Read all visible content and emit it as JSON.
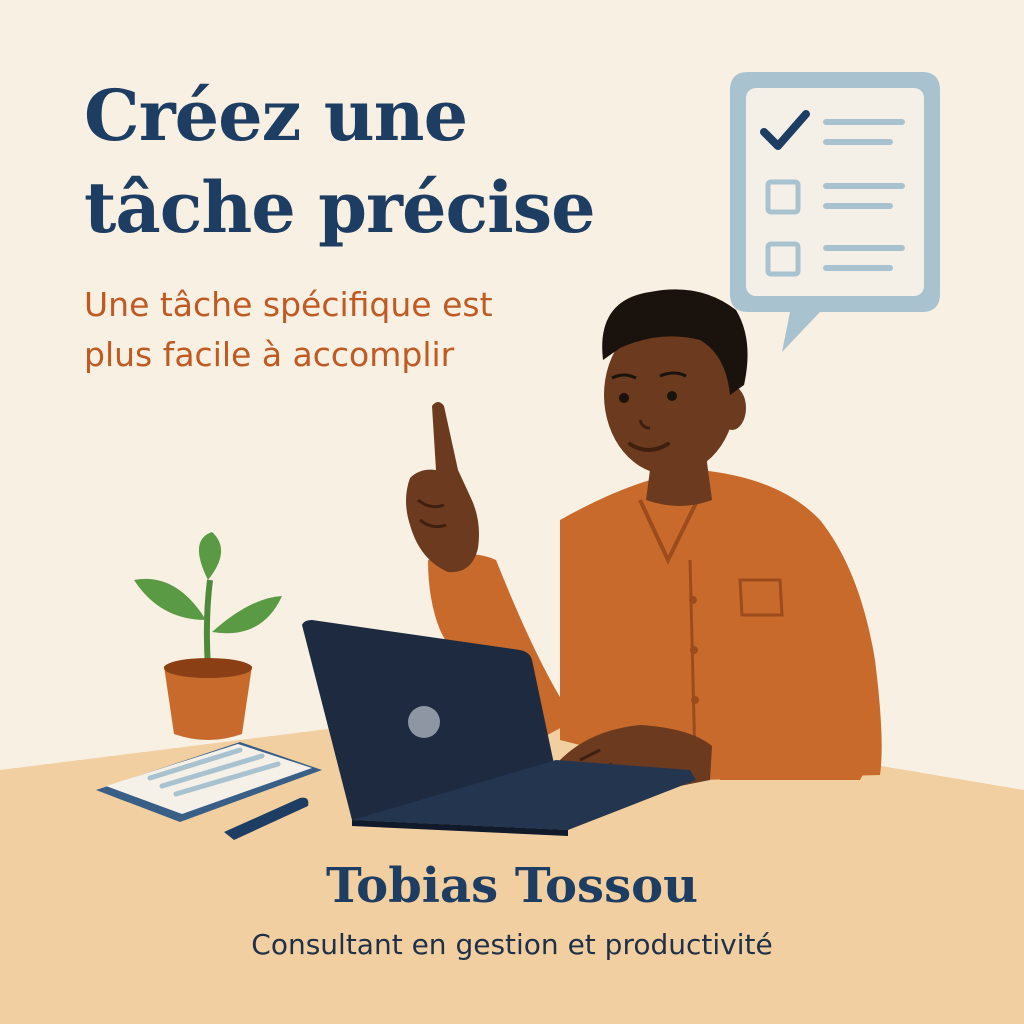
{
  "title": {
    "line1": "Créez une",
    "line2": "tâche précise"
  },
  "subtitle": {
    "line1": "Une tâche spécifique est",
    "line2": "plus facile à accomplir"
  },
  "author": {
    "name": "Tobias Tossou",
    "role": "Consultant en gestion et productivité"
  },
  "illustration": {
    "checklist_items": [
      {
        "checked": true
      },
      {
        "checked": false
      },
      {
        "checked": false
      }
    ],
    "icons": [
      "checklist-speech-bubble-icon",
      "checkmark-icon",
      "checkbox-icon",
      "plant-icon",
      "laptop-icon",
      "notepad-icon",
      "pen-icon"
    ]
  },
  "colors": {
    "background": "#f8f0e3",
    "desk": "#f2cfa0",
    "title": "#1e3d63",
    "subtitle": "#c05a23",
    "shirt": "#c86a2c",
    "skin": "#6b3a1f",
    "laptop": "#1d2a40",
    "bubble": "#a9c2cf"
  }
}
